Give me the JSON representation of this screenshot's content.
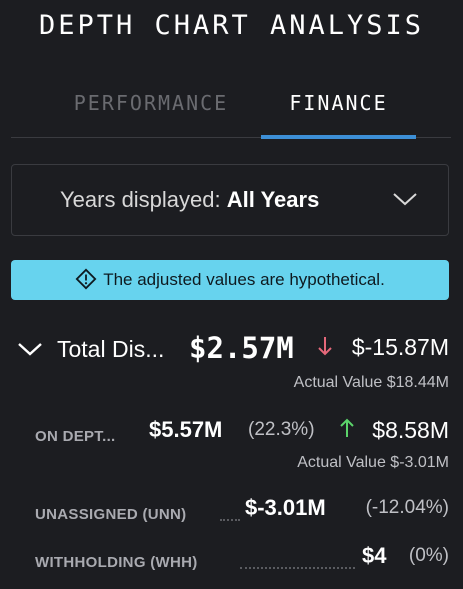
{
  "title": "DEPTH CHART ANALYSIS",
  "tabs": [
    {
      "label": "PERFORMANCE",
      "active": false
    },
    {
      "label": "FINANCE",
      "active": true
    }
  ],
  "years_select": {
    "prefix": "Years displayed: ",
    "value": "All Years"
  },
  "notice": {
    "text": "The adjusted values are hypothetical.",
    "icon": "warning-diamond-icon"
  },
  "total": {
    "label": "Total Dis...",
    "amount": "$2.57M",
    "change": "$-15.87M",
    "change_direction": "down",
    "actual": "Actual Value $18.44M"
  },
  "rows": [
    {
      "label": "ON DEPT...",
      "amount": "$5.57M",
      "pct": "(22.3%)",
      "change": "$8.58M",
      "change_direction": "up",
      "actual": "Actual Value $-3.01M"
    },
    {
      "label": "UNASSIGNED (UNN)",
      "amount": "$-3.01M",
      "pct": "(-12.04%)"
    },
    {
      "label": "WITHHOLDING (WHH)",
      "amount": "$4",
      "pct": "(0%)"
    }
  ],
  "colors": {
    "accent": "#3d8fd6",
    "notice_bg": "#67d3ee",
    "down": "#e5687a",
    "up": "#5bd36a"
  }
}
